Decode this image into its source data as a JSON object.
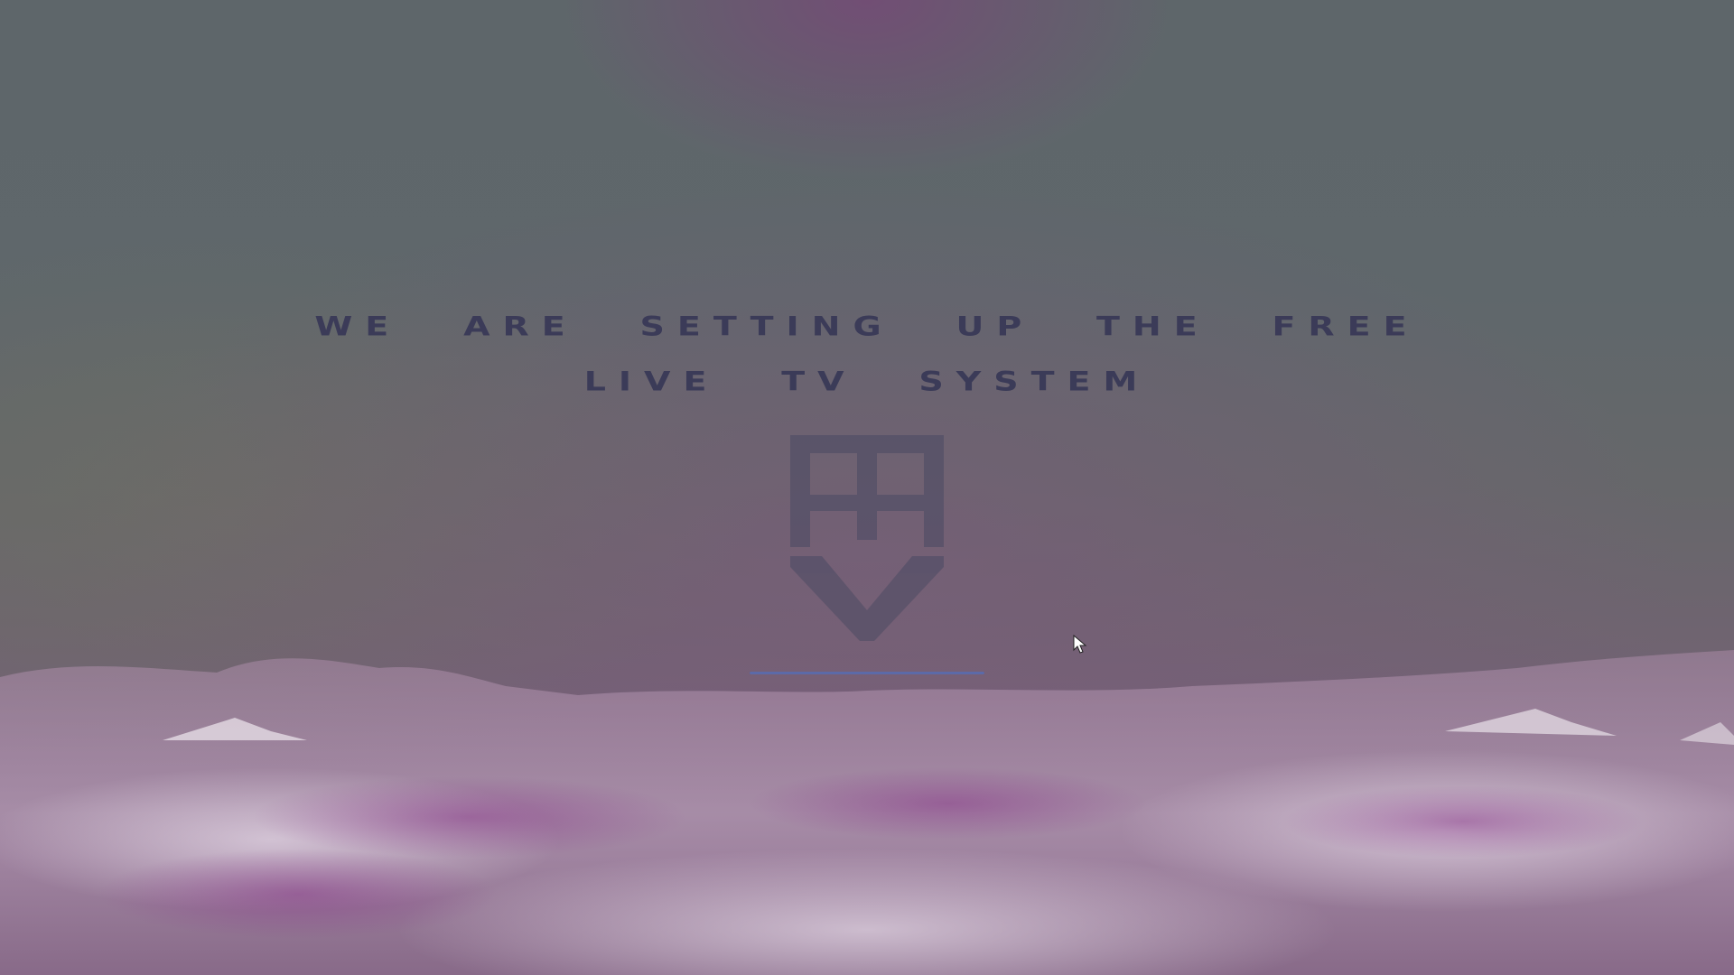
{
  "headline": {
    "line1": "we are setting up the free",
    "line2": "live tv system"
  },
  "logo": {
    "icon": "htv-shield-logo-icon",
    "lettering": "HTV"
  },
  "progress": {
    "fraction": 1.0
  },
  "colors": {
    "headline": "#3b3b58",
    "logo": "#4a4a63",
    "progress": "#5c6aa8",
    "clouds": "#d8c6da"
  }
}
